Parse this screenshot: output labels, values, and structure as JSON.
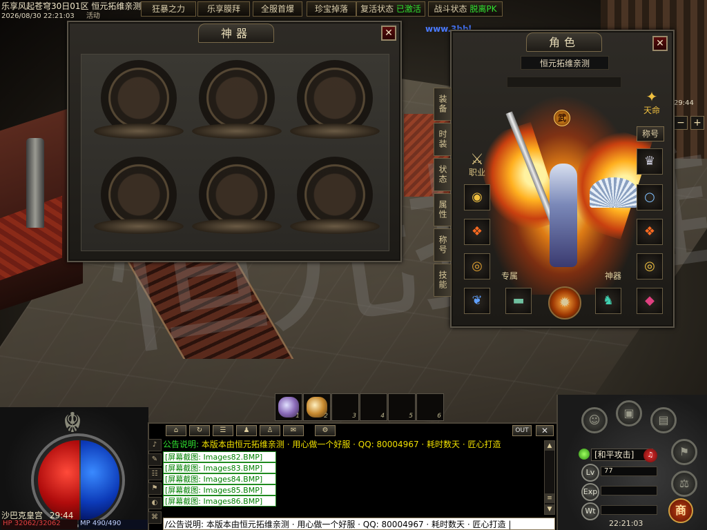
{
  "topbar": {
    "server": "乐享风起苍穹30日01区  恒元拓维亲测",
    "datetime": "2026/08/30 22:21:03",
    "hidden_tab": "活动",
    "buttons": [
      {
        "label": "狂暴之力"
      },
      {
        "label": "乐享膜拜"
      },
      {
        "label": "全服首爆"
      },
      {
        "label": "珍宝掉落"
      }
    ],
    "revive_label": "复活状态",
    "revive_value": "已激活",
    "battle_label": "战斗状态",
    "battle_value": "脱离PK"
  },
  "world": {
    "site_text": "www.3bbl",
    "watermark": "恒元拓维",
    "mini_time": "29:44"
  },
  "artifact_panel": {
    "title": "神器",
    "close": "✕"
  },
  "role_panel": {
    "title": "角色",
    "close": "✕",
    "character_name": "恒元拓维亲测",
    "side_tabs": [
      "装备",
      "时装",
      "状态",
      "属性",
      "称号",
      "技能"
    ],
    "tianming": "天命",
    "chenghao": "称号",
    "zhiye": "职业",
    "wu": "武",
    "zhuanshu": "专属",
    "shenqi": "神器"
  },
  "hud": {
    "location": "沙巴克皇宫",
    "location_time": "29:44",
    "hp": "HP 32062/32062",
    "mp": "MP 490/490",
    "belt_numbers": [
      "1",
      "2",
      "3",
      "4",
      "5",
      "6"
    ],
    "chat_out": "OUT",
    "chat_close": "✕",
    "notice_label": "公告说明:",
    "notice_body": "本版本由恒元拓维亲测 · 用心做一个好服 · QQ: 80004967 · 耗时数天 · 匠心打造",
    "screenshots": [
      "[屏幕截图: Images82.BMP]",
      "[屏幕截图: Images83.BMP]",
      "[屏幕截图: Images84.BMP]",
      "[屏幕截图: Images85.BMP]",
      "[屏幕截图: Images86.BMP]"
    ],
    "input_text": "/公告说明: 本版本由恒元拓维亲测 · 用心做一个好服 · QQ: 80004967 · 耗时数天 · 匠心打造 |",
    "attack_mode": "[和平攻击]",
    "level_badge": "Lv",
    "level_value": "77",
    "exp_badge": "Exp",
    "weight_badge": "Wt",
    "shop": "商",
    "clock": "22:21:03"
  },
  "colors": {
    "notice_label": "#30e030",
    "notice_body": "#f0e000",
    "hp_orb": "#b00c0c",
    "mp_orb": "#0c3ab8",
    "status_active": "#30e030"
  }
}
